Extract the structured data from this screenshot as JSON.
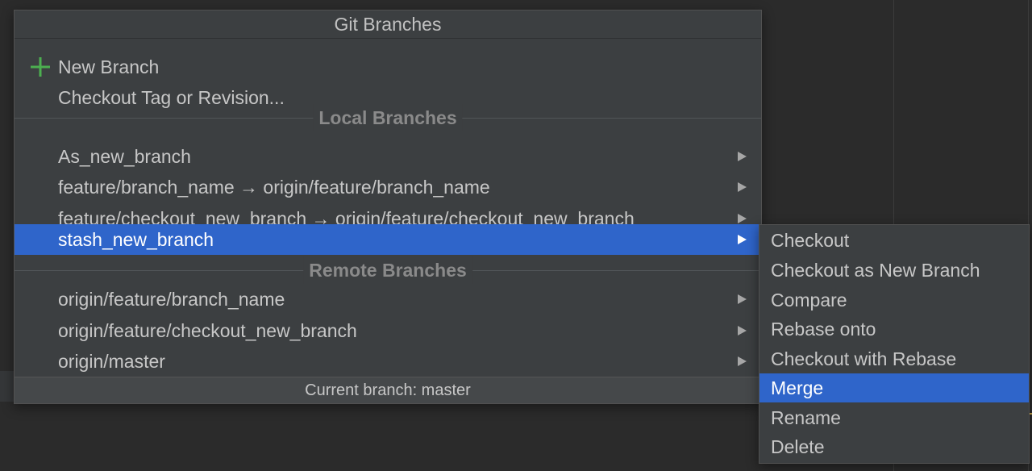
{
  "popup": {
    "title": "Git Branches",
    "actions": [
      {
        "label": "New Branch",
        "icon": "plus-icon"
      },
      {
        "label": "Checkout Tag or Revision..."
      }
    ],
    "local_header": "Local Branches",
    "local_branches": [
      {
        "label": "As_new_branch"
      },
      {
        "label": "feature/branch_name → origin/feature/branch_name"
      },
      {
        "label": "feature/checkout_new_branch → origin/feature/checkout_new_branch"
      },
      {
        "label": "stash_new_branch",
        "selected": true
      }
    ],
    "remote_header": "Remote Branches",
    "remote_branches": [
      {
        "label": "origin/feature/branch_name"
      },
      {
        "label": "origin/feature/checkout_new_branch"
      },
      {
        "label": "origin/master"
      }
    ],
    "footer": "Current branch: master"
  },
  "submenu": {
    "items": [
      {
        "label": "Checkout"
      },
      {
        "label": "Checkout as New Branch"
      },
      {
        "label": "Compare"
      },
      {
        "label": "Rebase onto"
      },
      {
        "label": "Checkout with Rebase"
      },
      {
        "label": "Merge",
        "selected": true
      },
      {
        "label": "Rename"
      },
      {
        "label": "Delete"
      }
    ]
  },
  "colors": {
    "selection": "#2f65ca",
    "popup_bg": "#3c3f41",
    "plus_icon": "#4caf50",
    "header_text": "#8a8a8a"
  }
}
